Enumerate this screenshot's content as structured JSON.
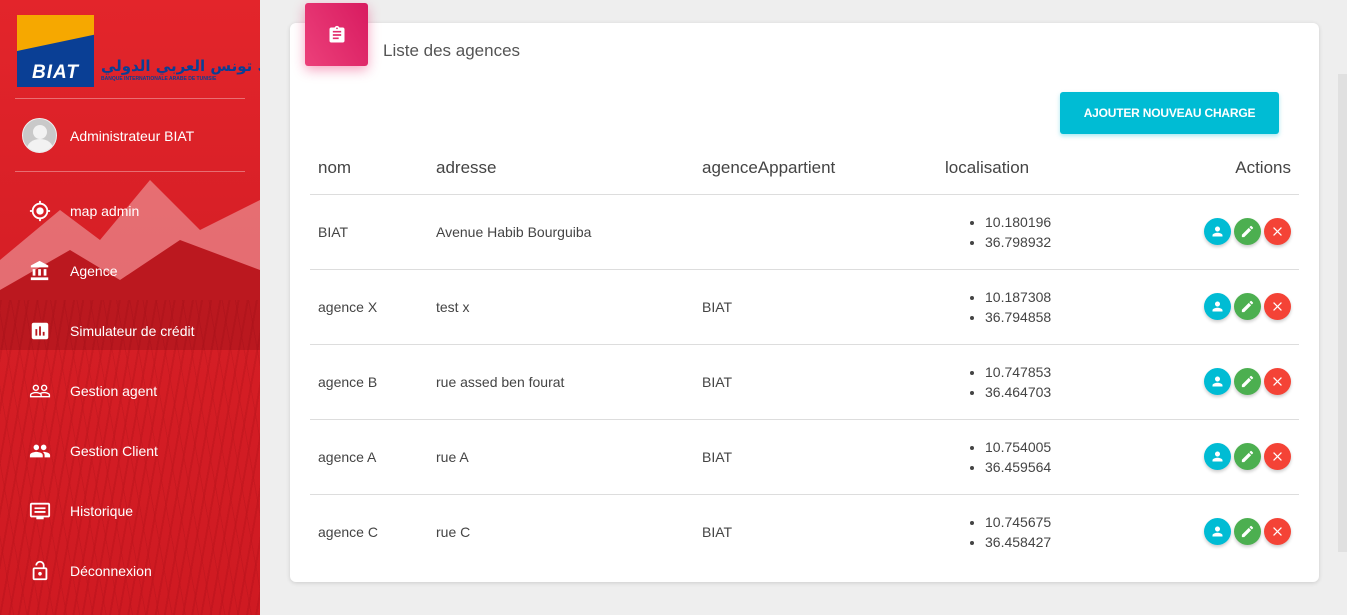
{
  "sidebar": {
    "logo": {
      "brand": "BIAT",
      "arabic": "بنك تونس العربي الدولي",
      "subtitle": "BANQUE INTERNATIONALE ARABE DE TUNISIE"
    },
    "user_name": "Administrateur BIAT",
    "items": [
      {
        "label": "map admin",
        "icon": "target-icon"
      },
      {
        "label": "Agence",
        "icon": "bank-icon"
      },
      {
        "label": "Simulateur de crédit",
        "icon": "chart-icon"
      },
      {
        "label": "Gestion agent",
        "icon": "people-outline-icon"
      },
      {
        "label": "Gestion Client",
        "icon": "people-icon"
      },
      {
        "label": "Historique",
        "icon": "monitor-icon"
      },
      {
        "label": "Déconnexion",
        "icon": "lock-open-icon"
      }
    ]
  },
  "main": {
    "title": "Liste des agences",
    "add_button": "AJOUTER NOUVEAU CHARGE",
    "columns": [
      "nom",
      "adresse",
      "agenceAppartient",
      "localisation",
      "Actions"
    ],
    "rows": [
      {
        "nom": "BIAT",
        "adresse": "Avenue Habib Bourguiba",
        "agence": "",
        "loc": [
          "10.180196",
          "36.798932"
        ]
      },
      {
        "nom": "agence X",
        "adresse": "test x",
        "agence": "BIAT",
        "loc": [
          "10.187308",
          "36.794858"
        ]
      },
      {
        "nom": "agence B",
        "adresse": "rue assed ben fourat",
        "agence": "BIAT",
        "loc": [
          "10.747853",
          "36.464703"
        ]
      },
      {
        "nom": "agence A",
        "adresse": "rue A",
        "agence": "BIAT",
        "loc": [
          "10.754005",
          "36.459564"
        ]
      },
      {
        "nom": "agence C",
        "adresse": "rue C",
        "agence": "BIAT",
        "loc": [
          "10.745675",
          "36.458427"
        ]
      }
    ]
  },
  "colors": {
    "sidebar": "#d71f26",
    "accent_pink": "#e91e63",
    "button_cyan": "#00bcd4",
    "edit_green": "#4caf50",
    "delete_red": "#f44336"
  }
}
